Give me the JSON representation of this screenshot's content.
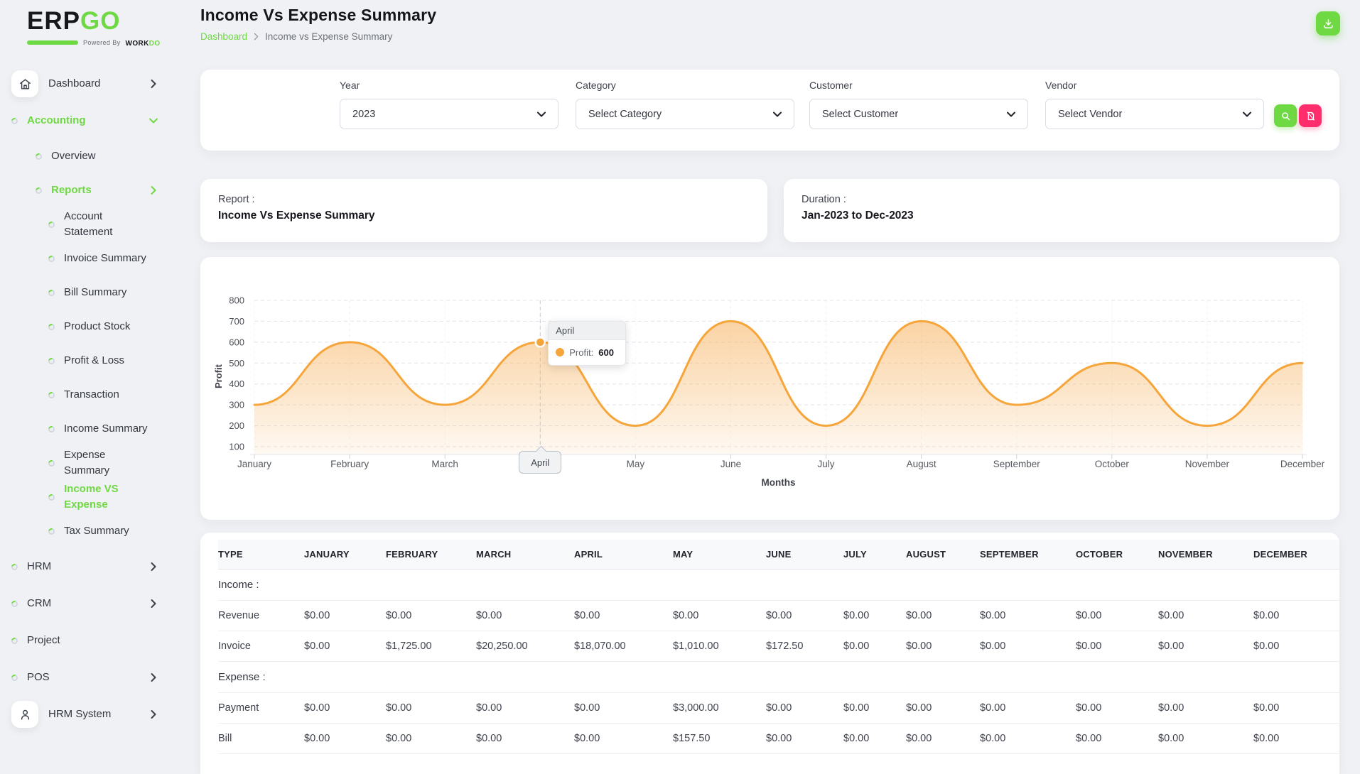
{
  "brand": {
    "name_primary": "ERP",
    "name_secondary": "GO",
    "powered_by": "Powered By",
    "powered_brand_dark": "WORK",
    "powered_brand_green": "DO"
  },
  "header": {
    "title": "Income Vs Expense Summary",
    "breadcrumb_home": "Dashboard",
    "breadcrumb_current": "Income vs Expense Summary"
  },
  "sidebar": {
    "items": [
      {
        "label": "Dashboard",
        "level": 1,
        "icon": "home",
        "chevron": "right",
        "active": false
      },
      {
        "label": "Accounting",
        "level": 1,
        "bullet": true,
        "chevron": "down",
        "active": true
      },
      {
        "label": "Overview",
        "level": 2,
        "bullet": true,
        "active": false
      },
      {
        "label": "Reports",
        "level": 2,
        "bullet": true,
        "chevron": "right",
        "active": true
      },
      {
        "label": "Account",
        "label2": "Statement",
        "level": 3,
        "bullet": true,
        "active": false
      },
      {
        "label": "Invoice Summary",
        "level": 3,
        "bullet": true,
        "active": false
      },
      {
        "label": "Bill Summary",
        "level": 3,
        "bullet": true,
        "active": false
      },
      {
        "label": "Product Stock",
        "level": 3,
        "bullet": true,
        "active": false
      },
      {
        "label": "Profit & Loss",
        "level": 3,
        "bullet": true,
        "active": false
      },
      {
        "label": "Transaction",
        "level": 3,
        "bullet": true,
        "active": false
      },
      {
        "label": "Income Summary",
        "level": 3,
        "bullet": true,
        "active": false
      },
      {
        "label": "Expense",
        "label2": "Summary",
        "level": 3,
        "bullet": true,
        "active": false
      },
      {
        "label": "Income VS",
        "label2": "Expense",
        "level": 3,
        "bullet": true,
        "active": true
      },
      {
        "label": "Tax Summary",
        "level": 3,
        "bullet": true,
        "active": false
      },
      {
        "label": "HRM",
        "level": 1,
        "bullet": true,
        "chevron": "right",
        "active": false
      },
      {
        "label": "CRM",
        "level": 1,
        "bullet": true,
        "chevron": "right",
        "active": false
      },
      {
        "label": "Project",
        "level": 1,
        "bullet": true,
        "active": false
      },
      {
        "label": "POS",
        "level": 1,
        "bullet": true,
        "chevron": "right",
        "active": false
      },
      {
        "label": "HRM System",
        "level": 1,
        "icon": "person",
        "chevron": "right",
        "active": false
      }
    ]
  },
  "filters": {
    "year": {
      "label": "Year",
      "value": "2023"
    },
    "category": {
      "label": "Category",
      "value": "Select Category"
    },
    "customer": {
      "label": "Customer",
      "value": "Select Customer"
    },
    "vendor": {
      "label": "Vendor",
      "value": "Select Vendor"
    }
  },
  "summary_cards": {
    "report_label": "Report :",
    "report_value": "Income Vs Expense Summary",
    "duration_label": "Duration :",
    "duration_value": "Jan-2023 to Dec-2023"
  },
  "chart_data": {
    "type": "area",
    "x": [
      "January",
      "February",
      "March",
      "April",
      "May",
      "June",
      "July",
      "August",
      "September",
      "October",
      "November",
      "December"
    ],
    "series": [
      {
        "name": "Profit",
        "values": [
          300,
          600,
          300,
          600,
          200,
          700,
          200,
          700,
          300,
          500,
          200,
          500
        ]
      }
    ],
    "xlabel": "Months",
    "ylabel": "Profit",
    "ylim": [
      100,
      800
    ],
    "yticks": [
      800,
      700,
      600,
      500,
      400,
      300,
      200,
      100
    ],
    "grid": "dashed",
    "line_color": "#f6a53a",
    "fill": "orange-gradient",
    "legend_position": "none",
    "selected_point": {
      "label": "April",
      "series": "Profit",
      "value": 600
    },
    "tooltip": {
      "title": "April",
      "series_label": "Profit:",
      "value": "600"
    }
  },
  "table": {
    "headers": [
      "TYPE",
      "JANUARY",
      "FEBRUARY",
      "MARCH",
      "APRIL",
      "MAY",
      "JUNE",
      "JULY",
      "AUGUST",
      "SEPTEMBER",
      "OCTOBER",
      "NOVEMBER",
      "DECEMBER"
    ],
    "sections": [
      {
        "label": "Income :",
        "rows": [
          {
            "type": "Revenue",
            "values": [
              "$0.00",
              "$0.00",
              "$0.00",
              "$0.00",
              "$0.00",
              "$0.00",
              "$0.00",
              "$0.00",
              "$0.00",
              "$0.00",
              "$0.00",
              "$0.00"
            ]
          },
          {
            "type": "Invoice",
            "values": [
              "$0.00",
              "$1,725.00",
              "$20,250.00",
              "$18,070.00",
              "$1,010.00",
              "$172.50",
              "$0.00",
              "$0.00",
              "$0.00",
              "$0.00",
              "$0.00",
              "$0.00"
            ]
          }
        ]
      },
      {
        "label": "Expense :",
        "rows": [
          {
            "type": "Payment",
            "values": [
              "$0.00",
              "$0.00",
              "$0.00",
              "$0.00",
              "$3,000.00",
              "$0.00",
              "$0.00",
              "$0.00",
              "$0.00",
              "$0.00",
              "$0.00",
              "$0.00"
            ]
          },
          {
            "type": "Bill",
            "values": [
              "$0.00",
              "$0.00",
              "$0.00",
              "$0.00",
              "$157.50",
              "$0.00",
              "$0.00",
              "$0.00",
              "$0.00",
              "$0.00",
              "$0.00",
              "$0.00"
            ]
          }
        ]
      }
    ]
  }
}
